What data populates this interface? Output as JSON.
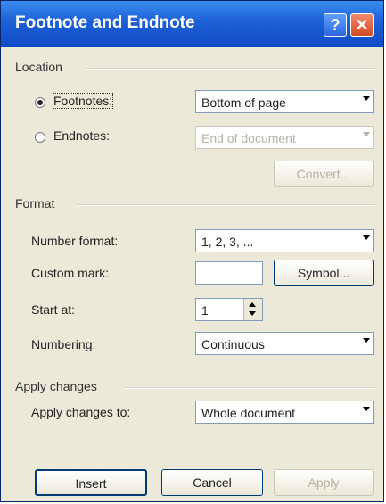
{
  "window": {
    "title": "Footnote and Endnote",
    "help_glyph": "?",
    "close_glyph": "✕"
  },
  "location": {
    "section_label": "Location",
    "footnotes_label": "Footnotes:",
    "footnotes_value": "Bottom of page",
    "footnotes_selected": true,
    "endnotes_label": "Endnotes:",
    "endnotes_value": "End of document",
    "convert_label": "Convert..."
  },
  "format": {
    "section_label": "Format",
    "number_format_label": "Number format:",
    "number_format_value": "1, 2, 3, ...",
    "custom_mark_label": "Custom mark:",
    "custom_mark_value": "",
    "symbol_label": "Symbol...",
    "start_at_label": "Start at:",
    "start_at_value": "1",
    "numbering_label": "Numbering:",
    "numbering_value": "Continuous"
  },
  "apply_changes": {
    "section_label": "Apply changes",
    "apply_to_label": "Apply changes to:",
    "apply_to_value": "Whole document"
  },
  "buttons": {
    "insert": "Insert",
    "cancel": "Cancel",
    "apply": "Apply"
  }
}
